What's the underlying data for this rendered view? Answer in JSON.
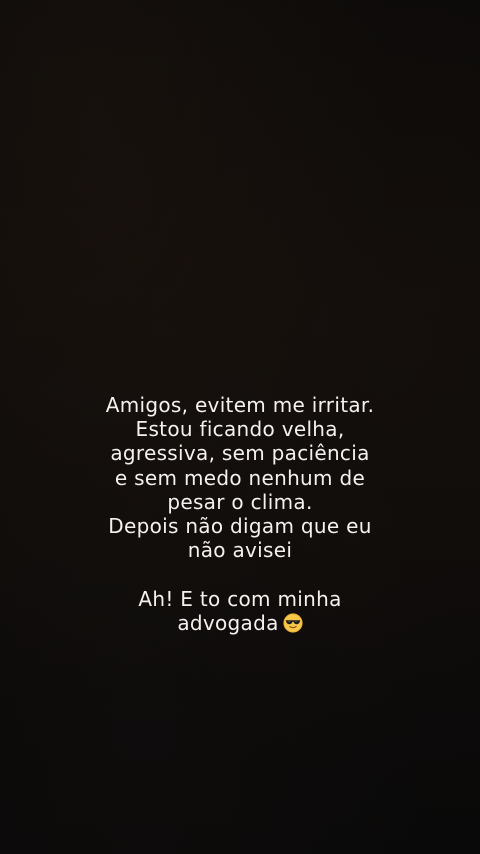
{
  "story": {
    "lines": [
      "Amigos, evitem me irritar.",
      "Estou ficando velha,",
      "agressiva, sem paciência",
      "e sem medo nenhum de",
      "pesar o clima.",
      "Depois não digam que eu",
      "não avisei",
      "Ah! E to com minha",
      "advogada"
    ],
    "emoji": "smiling-face-with-sunglasses"
  },
  "colors": {
    "text": "#f4f1ee",
    "background": "#0b0908"
  }
}
